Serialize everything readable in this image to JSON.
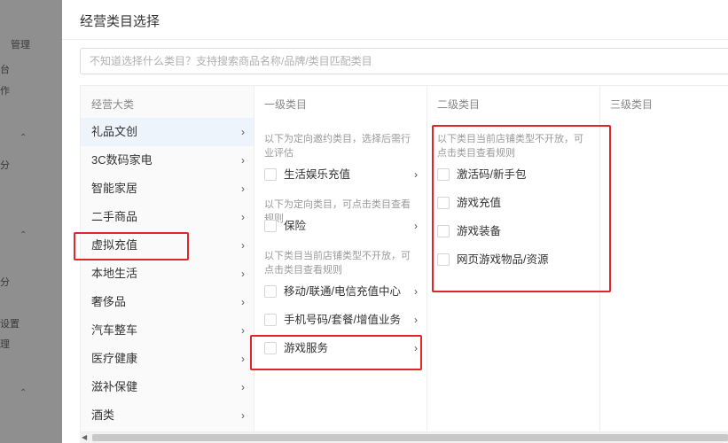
{
  "background_nav": {
    "items": [
      "管理",
      "台",
      "作",
      "分",
      "",
      "",
      "分",
      "设置",
      "理"
    ]
  },
  "modal": {
    "title": "经营类目选择",
    "search_placeholder": "不知道选择什么类目？支持搜索商品名称/品牌/类目匹配类目"
  },
  "columns": {
    "c0": {
      "header": "经营大类",
      "items": [
        "礼品文创",
        "3C数码家电",
        "智能家居",
        "二手商品",
        "虚拟充值",
        "本地生活",
        "奢侈品",
        "汽车整车",
        "医疗健康",
        "滋补保健",
        "酒类"
      ]
    },
    "c1": {
      "header": "一级类目",
      "note1": "以下为定向邀约类目，选择后需行业评估",
      "group1": [
        "生活娱乐充值"
      ],
      "note2": "以下为定向类目，可点击类目查看规则",
      "group2": [
        "保险"
      ],
      "note3": "以下类目当前店铺类型不开放，可点击类目查看规则",
      "group3": [
        "移动/联通/电信充值中心",
        "手机号码/套餐/增值业务",
        "游戏服务"
      ]
    },
    "c2": {
      "header": "二级类目",
      "note": "以下类目当前店铺类型不开放，可点击类目查看规则",
      "items": [
        "激活码/新手包",
        "游戏充值",
        "游戏装备",
        "网页游戏物品/资源"
      ]
    },
    "c3": {
      "header": "三级类目"
    }
  },
  "colors": {
    "highlight": "#e0262a",
    "active_row": "#eef4fb"
  },
  "icons": {
    "chevron": "chevron-right-icon"
  }
}
